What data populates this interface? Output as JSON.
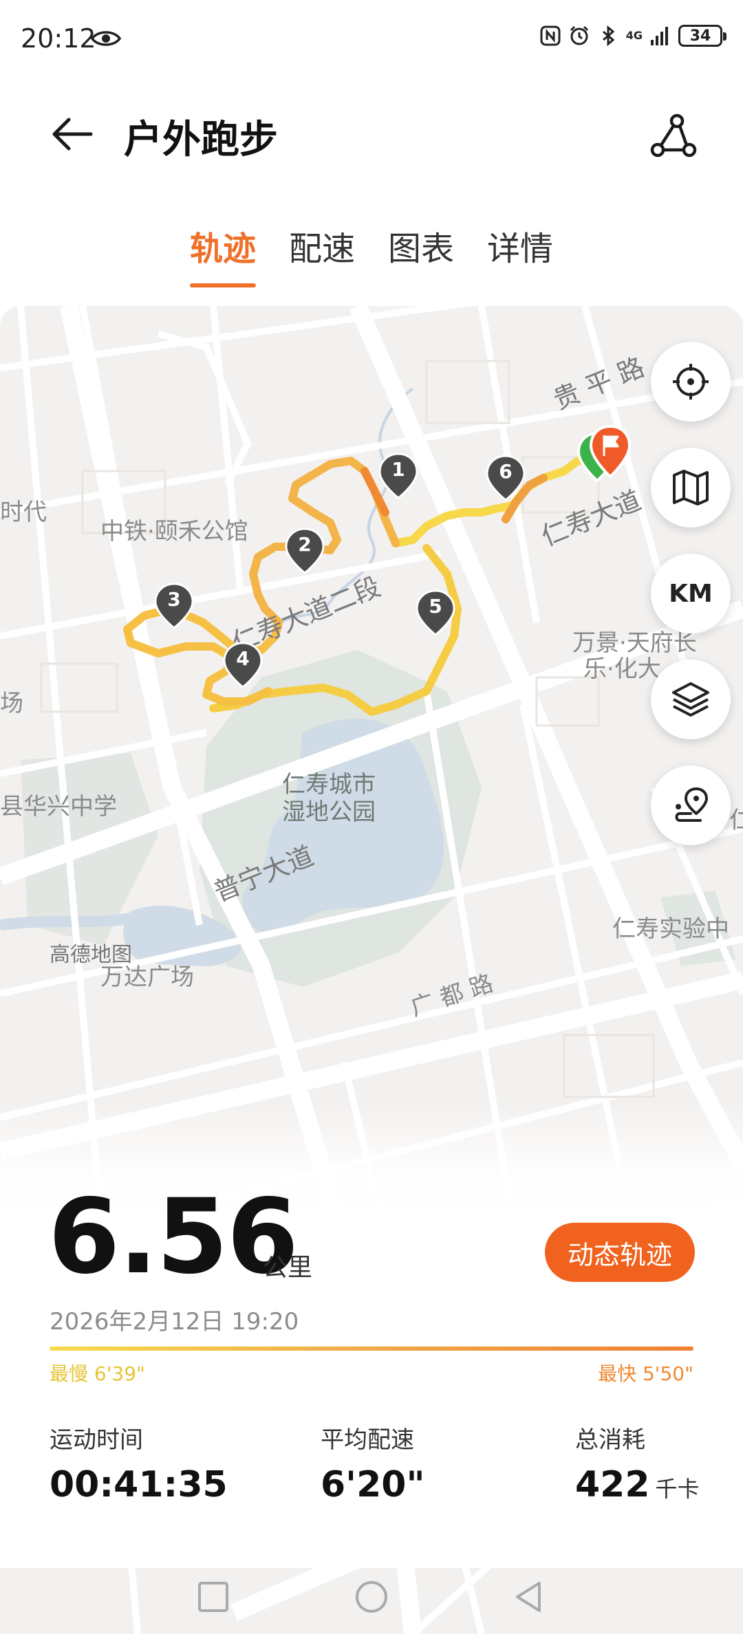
{
  "status_bar": {
    "time": "20:12",
    "battery": "34",
    "network": "4G",
    "icons": [
      "eye-icon",
      "nfc-icon",
      "alarm-icon",
      "bluetooth-icon",
      "signal-icon",
      "battery-icon"
    ]
  },
  "header": {
    "title": "户外跑步",
    "back_icon": "back-arrow-icon",
    "share_icon": "share-route-icon"
  },
  "tabs": [
    {
      "label": "轨迹",
      "active": true
    },
    {
      "label": "配速",
      "active": false
    },
    {
      "label": "图表",
      "active": false
    },
    {
      "label": "详情",
      "active": false
    }
  ],
  "map": {
    "labels": {
      "road_guiping": "贵 平 路",
      "road_renshou": "仁寿大道",
      "road_renshou_2": "仁寿大道二段",
      "road_puning": "普宁大道",
      "road_guangdu": "广 都 路",
      "poi_zhongtie": "中铁·颐禾公馆",
      "poi_wanjing_1": "万景·天府长",
      "poi_wanjing_2": "乐·化大",
      "poi_park_1": "仁寿城市",
      "poi_park_2": "湿地公园",
      "poi_school": "县华兴中学",
      "poi_shidai": "时代",
      "poi_chang": "场",
      "poi_shiyan": "仁寿实验中",
      "poi_wanda": "万达广场",
      "brand": "高德地图",
      "poi_right": "仁"
    },
    "km_markers": [
      "1",
      "2",
      "3",
      "4",
      "5",
      "6"
    ],
    "controls": [
      {
        "name": "locate-icon",
        "label": ""
      },
      {
        "name": "map-style-icon",
        "label": ""
      },
      {
        "name": "km-toggle",
        "label": "KM"
      },
      {
        "name": "layers-icon",
        "label": ""
      },
      {
        "name": "route-pin-icon",
        "label": ""
      }
    ]
  },
  "summary": {
    "distance": "6.56",
    "distance_unit": "公里",
    "dynamic_track_button": "动态轨迹",
    "date": "2026年2月12日 19:20",
    "pace_slowest": "最慢 6'39\"",
    "pace_fastest": "最快 5'50\""
  },
  "stats": [
    {
      "label": "运动时间",
      "value": "00:41:35",
      "unit": ""
    },
    {
      "label": "平均配速",
      "value": "6'20\"",
      "unit": ""
    },
    {
      "label": "总消耗",
      "value": "422",
      "unit": "千卡"
    }
  ],
  "colors": {
    "accent": "#f0702a",
    "button": "#f0621e",
    "route_slow": "#f6dc4c",
    "route_fast": "#f08030"
  }
}
